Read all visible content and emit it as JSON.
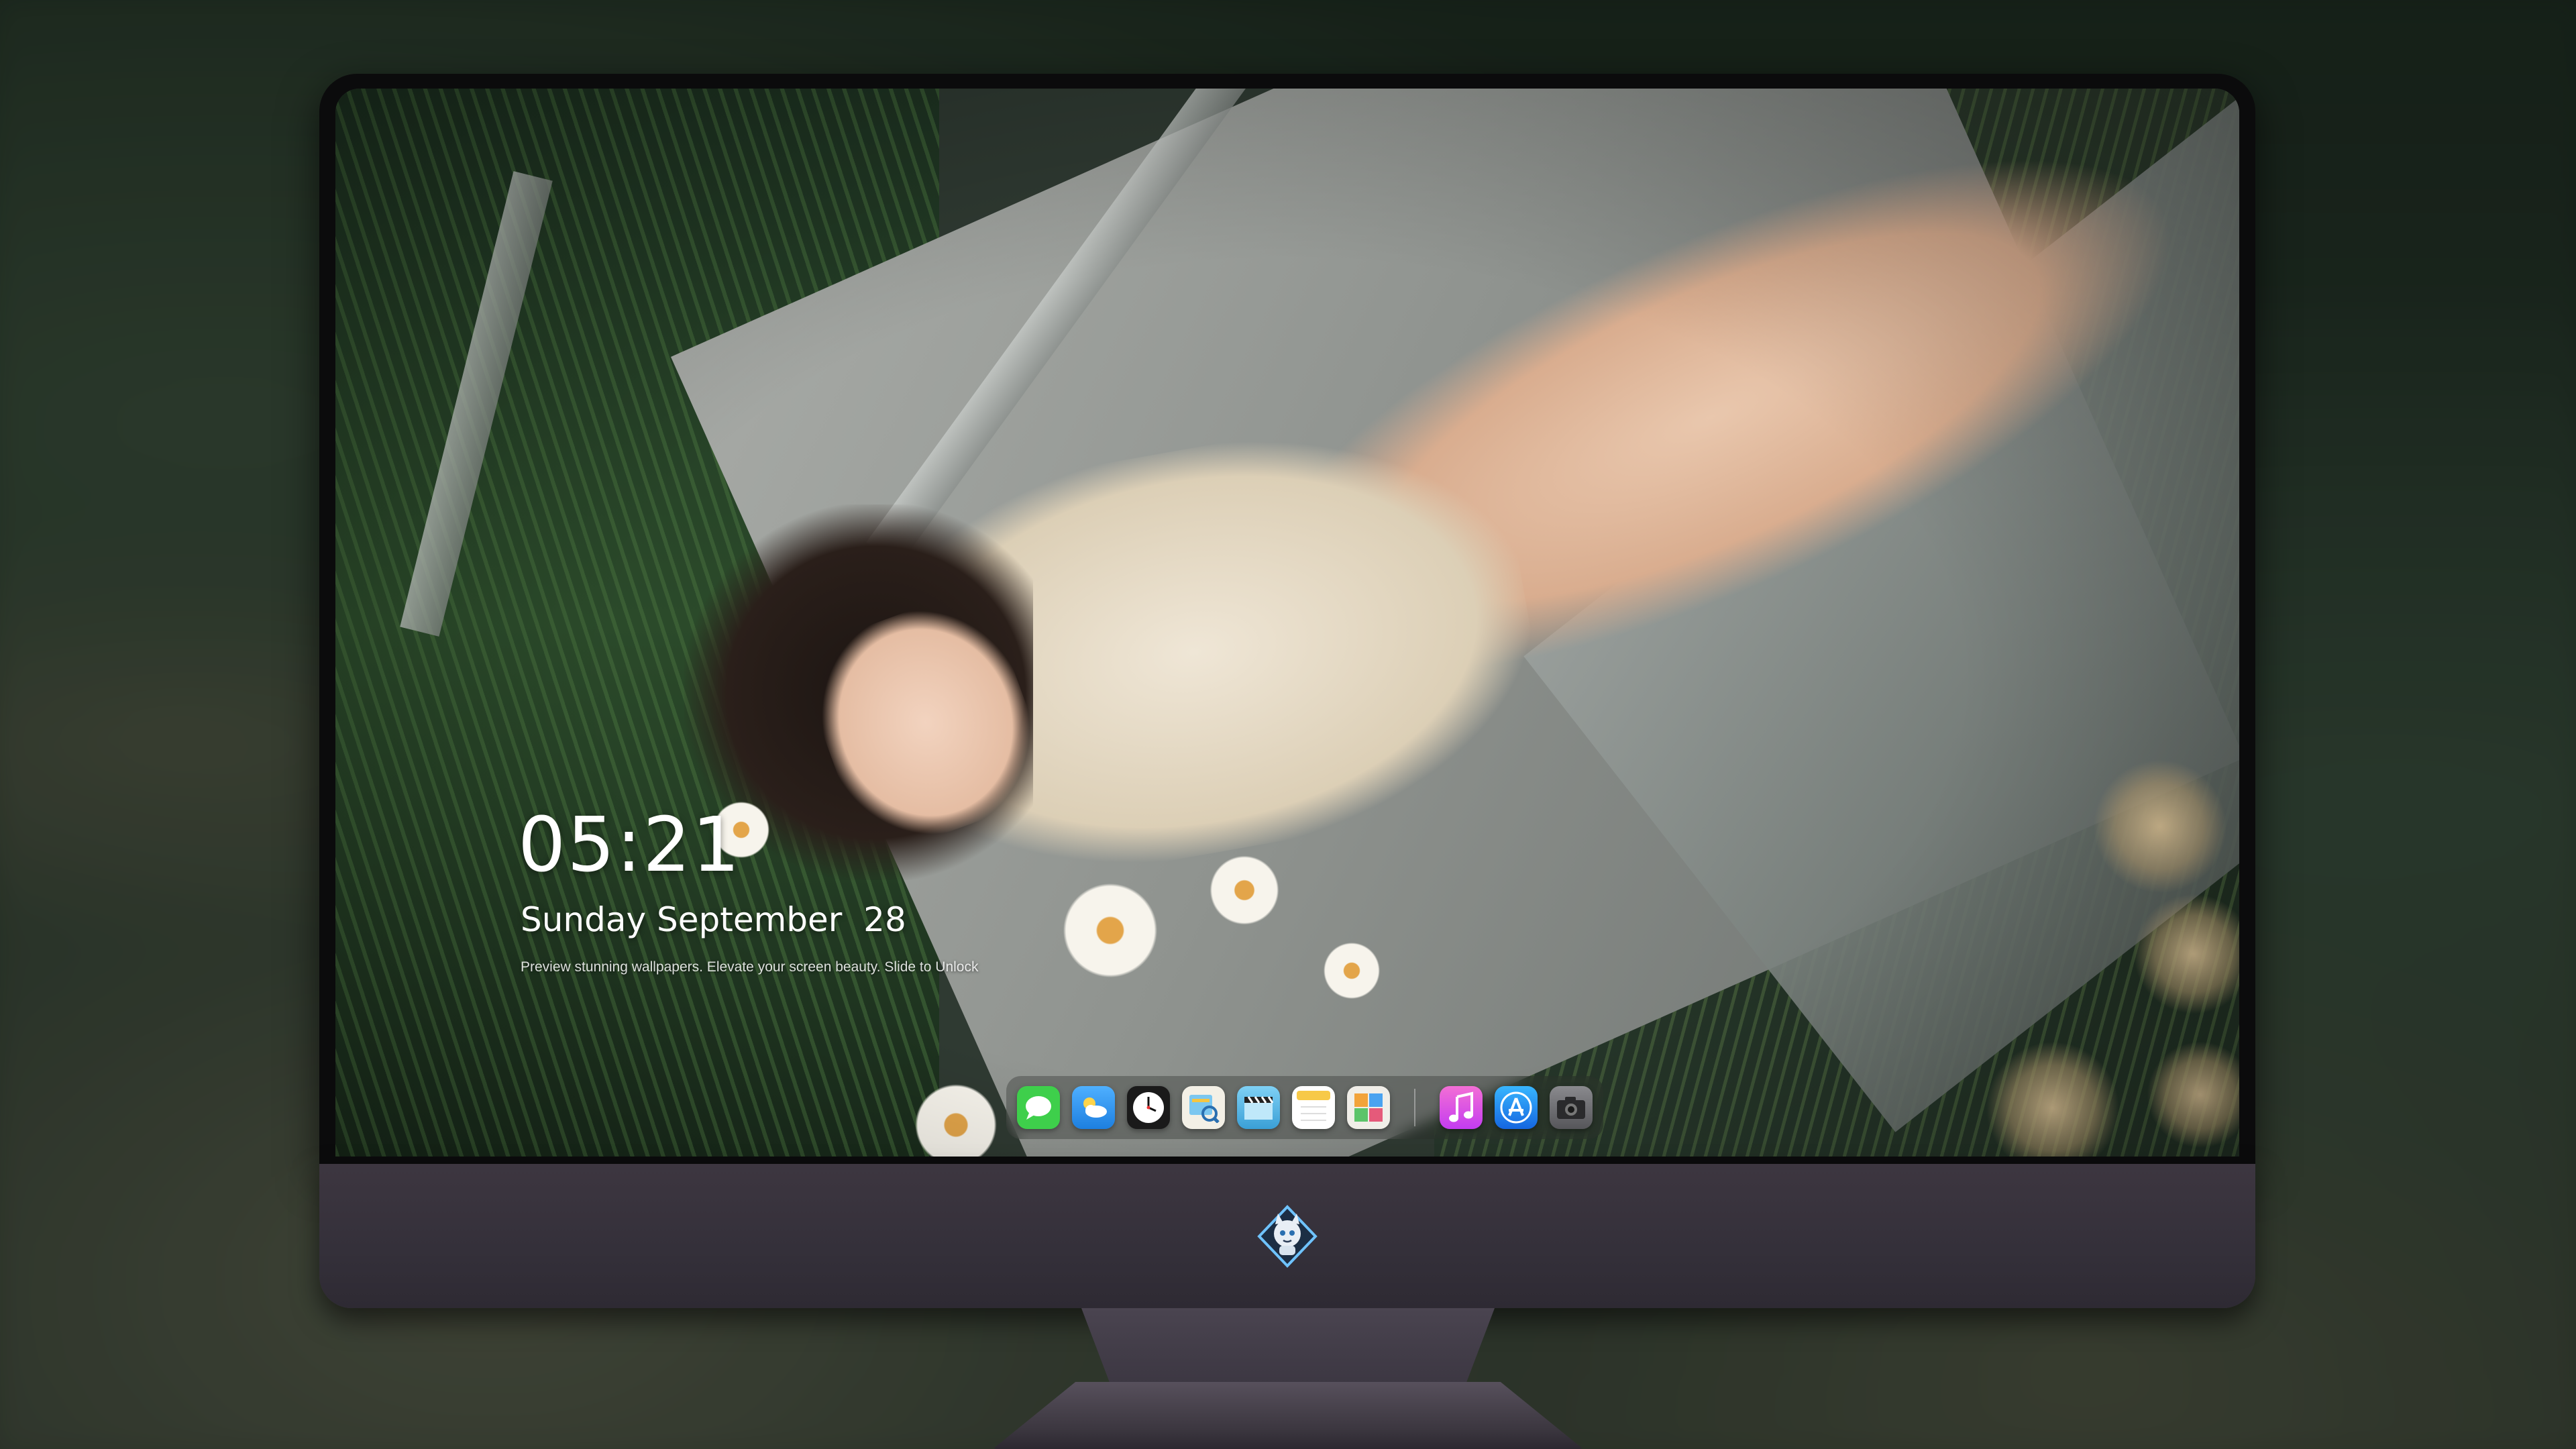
{
  "lock_screen": {
    "time": "05:21",
    "date": "Sunday September  28",
    "tagline": "Preview stunning wallpapers. Elevate your screen beauty. Slide to Unlock"
  },
  "dock": {
    "apps": [
      {
        "name": "messages-icon",
        "color": "#3ecf4b"
      },
      {
        "name": "weather-icon",
        "color": "#3d9ef5"
      },
      {
        "name": "clock-icon",
        "color": "#1a1a1a"
      },
      {
        "name": "preview-icon",
        "color": "#f3f0e6"
      },
      {
        "name": "video-clapper-icon",
        "color": "#5bb7e8"
      },
      {
        "name": "notes-icon",
        "color": "#ffffff"
      },
      {
        "name": "photo-gallery-icon",
        "color": "#f0eee8"
      },
      {
        "name": "itunes-music-icon",
        "color": "#ee4fc4"
      },
      {
        "name": "app-store-icon",
        "color": "#1e8ff0"
      },
      {
        "name": "camera-icon",
        "color": "#6e6e72"
      }
    ]
  },
  "monitor": {
    "brand_logo": "cat-mascot-logo"
  }
}
